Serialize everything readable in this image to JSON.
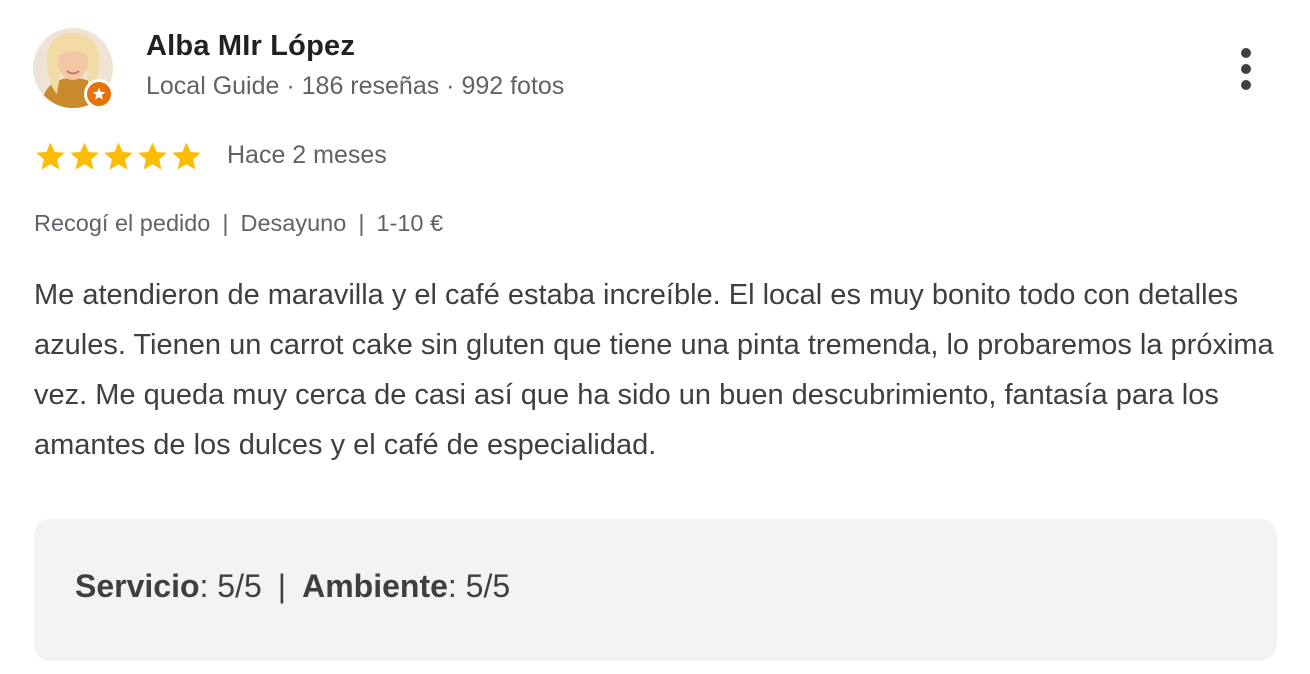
{
  "author": {
    "name": "Alba MIr López",
    "meta": "Local Guide · 186 reseñas · 992 fotos"
  },
  "review": {
    "rating": 5,
    "max_rating": 5,
    "date": "Hace 2 meses",
    "tags": [
      "Recogí el pedido",
      "Desayuno",
      "1-10 €"
    ],
    "tag_separator": "|",
    "text": "Me atendieron de maravilla y el café estaba increíble. El local es muy bonito todo con detalles azules. Tienen un carrot cake sin gluten que tiene una pinta tremenda, lo probaremos la próxima vez. Me queda muy cerca de casi así que ha sido un buen descubrimiento, fantasía para los amantes de los dulces y el café de especialidad."
  },
  "subratings": {
    "separator": "|",
    "items": [
      {
        "label": "Servicio",
        "value": "5/5"
      },
      {
        "label": "Ambiente",
        "value": "5/5"
      }
    ]
  },
  "icons": {
    "avatar": "profile-photo",
    "badge": "local-guide-star-icon",
    "more": "more-vert-icon",
    "star": "star-icon"
  },
  "colors": {
    "star": "#fbbc04",
    "badge": "#e8710a",
    "panel": "#f1f3f4",
    "secondary_text": "#5f6368"
  }
}
